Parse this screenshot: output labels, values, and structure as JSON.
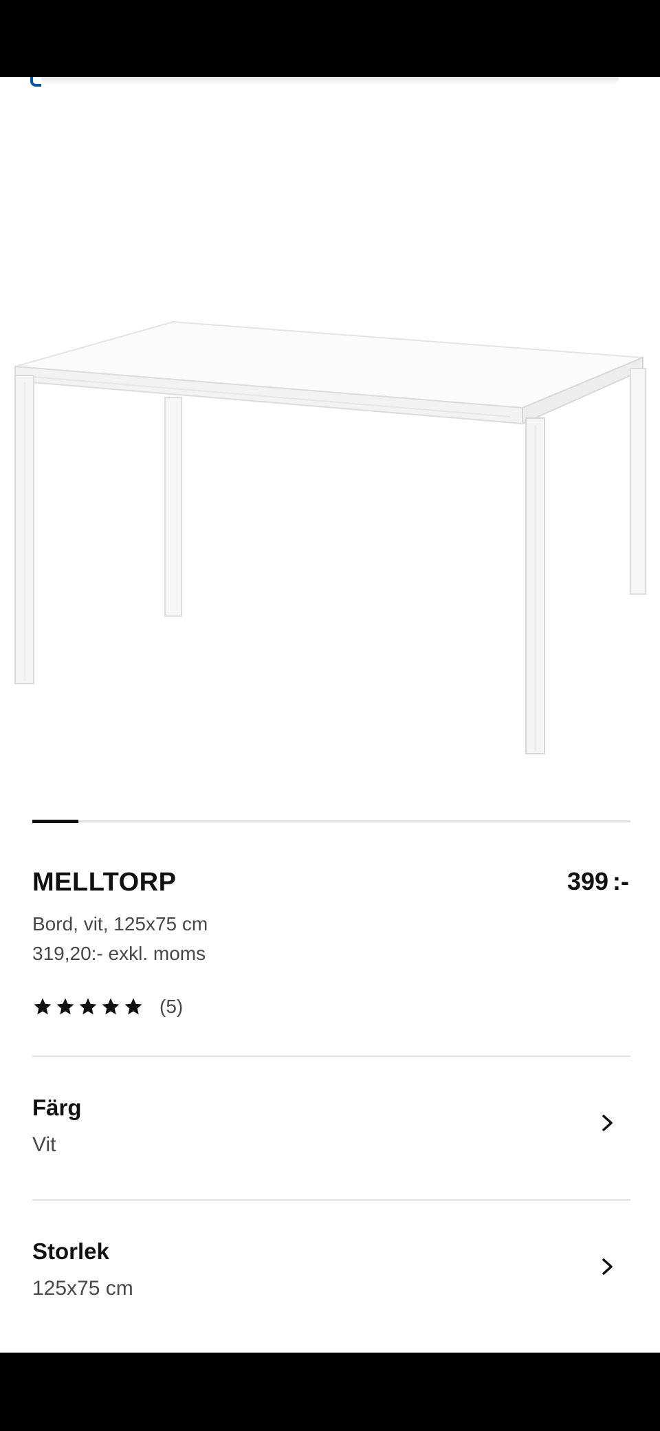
{
  "product": {
    "name": "MELLTORP",
    "price_value": "399",
    "price_suffix": ":-",
    "description": "Bord, vit, 125x75 cm",
    "price_excl_vat": "319,20:- exkl. moms",
    "rating": {
      "stars": 5,
      "max_stars": 5,
      "count_text": "(5)"
    }
  },
  "carousel": {
    "active_index": 0
  },
  "options": [
    {
      "label": "Färg",
      "value": "Vit",
      "icon": "chevron-right-icon"
    },
    {
      "label": "Storlek",
      "value": "125x75 cm",
      "icon": "chevron-right-icon"
    }
  ],
  "colors": {
    "text": "#111111",
    "secondary_text": "#484848",
    "divider": "#e0e0e0",
    "accent": "#0058a3"
  }
}
